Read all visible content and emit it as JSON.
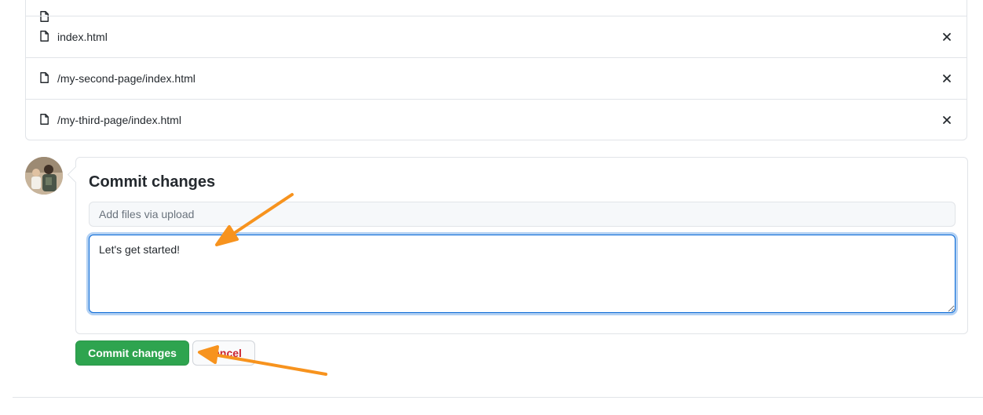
{
  "files": [
    {
      "name": ""
    },
    {
      "name": "index.html"
    },
    {
      "name": "/my-second-page/index.html"
    },
    {
      "name": "/my-third-page/index.html"
    }
  ],
  "icons": {
    "file": "file-icon",
    "remove": "close-icon"
  },
  "commit": {
    "title": "Commit changes",
    "summary_placeholder": "Add files via upload",
    "summary_value": "",
    "description_value": "Let's get started!",
    "commit_button_label": "Commit changes",
    "cancel_button_label": "Cancel"
  },
  "colors": {
    "commit_button": "#2ea44f",
    "cancel_text": "#cb2431",
    "focus_border": "#0366d6",
    "annotation_arrow": "#f7931e"
  }
}
